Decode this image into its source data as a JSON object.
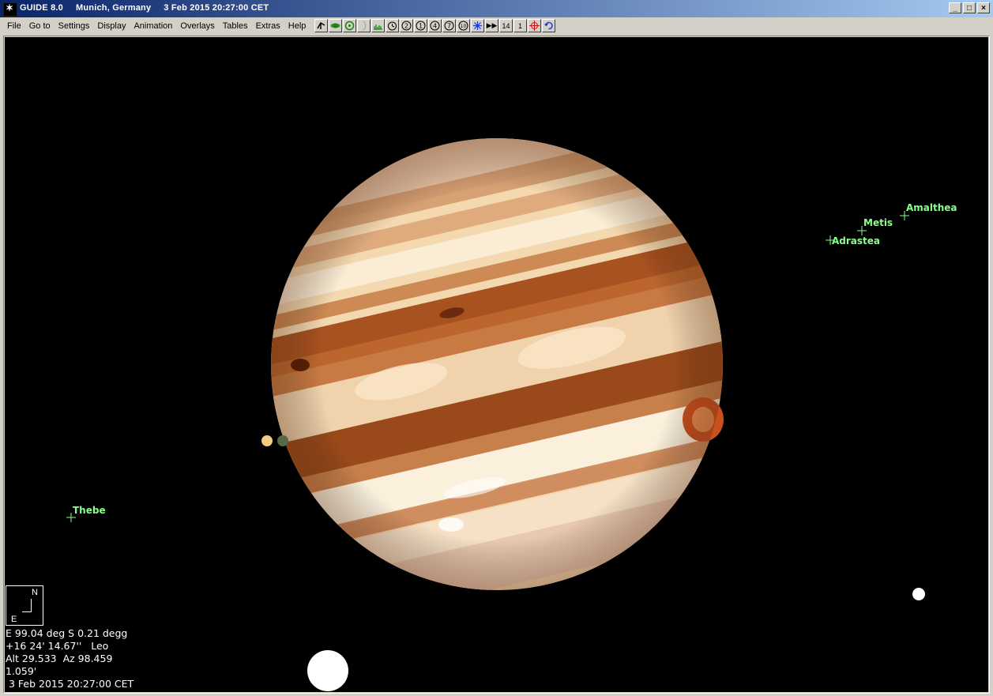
{
  "window": {
    "app": "GUIDE 8.0",
    "location": "Munich, Germany",
    "datetime": "3 Feb 2015 20:27:00 CET",
    "controls": [
      "_",
      "□",
      "×"
    ]
  },
  "menu": [
    "File",
    "Go to",
    "Settings",
    "Display",
    "Animation",
    "Overlays",
    "Tables",
    "Extras",
    "Help"
  ],
  "toolbar": [
    {
      "icon": "binoculars-icon",
      "label": ""
    },
    {
      "icon": "planet-icon",
      "label": ""
    },
    {
      "icon": "target-icon",
      "label": ""
    },
    {
      "icon": "moon-icon",
      "label": ""
    },
    {
      "icon": "horizon-icon",
      "label": ""
    },
    {
      "icon": "clock-icon",
      "label": ""
    },
    {
      "icon": "zoom-2-icon",
      "label": "2"
    },
    {
      "icon": "zoom-1-icon",
      "label": "1"
    },
    {
      "icon": "zoom-4-icon",
      "label": "4"
    },
    {
      "icon": "zoom-7-icon",
      "label": "7"
    },
    {
      "icon": "zoom-10-icon",
      "label": "10"
    },
    {
      "icon": "star-chart-icon",
      "label": ""
    },
    {
      "icon": "fast-forward-icon",
      "label": "▶▶"
    },
    {
      "icon": "step-14-icon",
      "label": "14"
    },
    {
      "icon": "step-1-icon",
      "label": "1"
    },
    {
      "icon": "crosshair-icon",
      "label": ""
    },
    {
      "icon": "undo-icon",
      "label": ""
    }
  ],
  "moons": {
    "amalthea": "Amalthea",
    "metis": "Metis",
    "adrastea": "Adrastea",
    "thebe": "Thebe"
  },
  "compass": {
    "north": "N",
    "east": "E"
  },
  "info": {
    "line1": "E 99.04 deg S 0.21 degg",
    "line2": "+16 24' 14.67''   Leo",
    "line3": "Alt 29.533  Az 98.459",
    "line4": "1.059'",
    "line5": " 3 Feb 2015 20:27:00 CET"
  },
  "colors": {
    "moon_label": "#8cff8c",
    "sky": "#000000",
    "title_gradient_start": "#0a246a"
  }
}
